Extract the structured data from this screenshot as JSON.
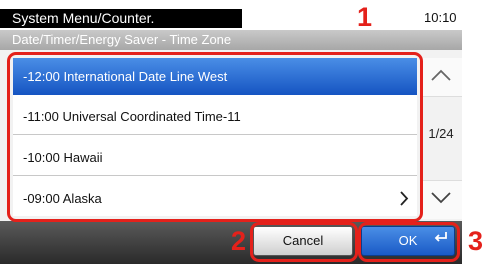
{
  "header": {
    "title": "System Menu/Counter.",
    "subtitle": "Date/Timer/Energy Saver - Time Zone",
    "time": "10:10"
  },
  "list": {
    "items": [
      {
        "label": "-12:00 International Date Line West",
        "selected": true
      },
      {
        "label": "-11:00 Universal Coordinated Time-11",
        "selected": false
      },
      {
        "label": "-10:00 Hawaii",
        "selected": false
      },
      {
        "label": "-09:00 Alaska",
        "selected": false
      }
    ]
  },
  "pager": {
    "indicator": "1/24"
  },
  "footer": {
    "cancel_label": "Cancel",
    "ok_label": "OK"
  },
  "callouts": {
    "one": "1",
    "two": "2",
    "three": "3"
  },
  "colors": {
    "accent_blue": "#1a5ac6",
    "callout_red": "#e4211b"
  },
  "icons": [
    "scroll-up-icon",
    "scroll-down-icon",
    "chevron-right-icon",
    "enter-icon"
  ]
}
